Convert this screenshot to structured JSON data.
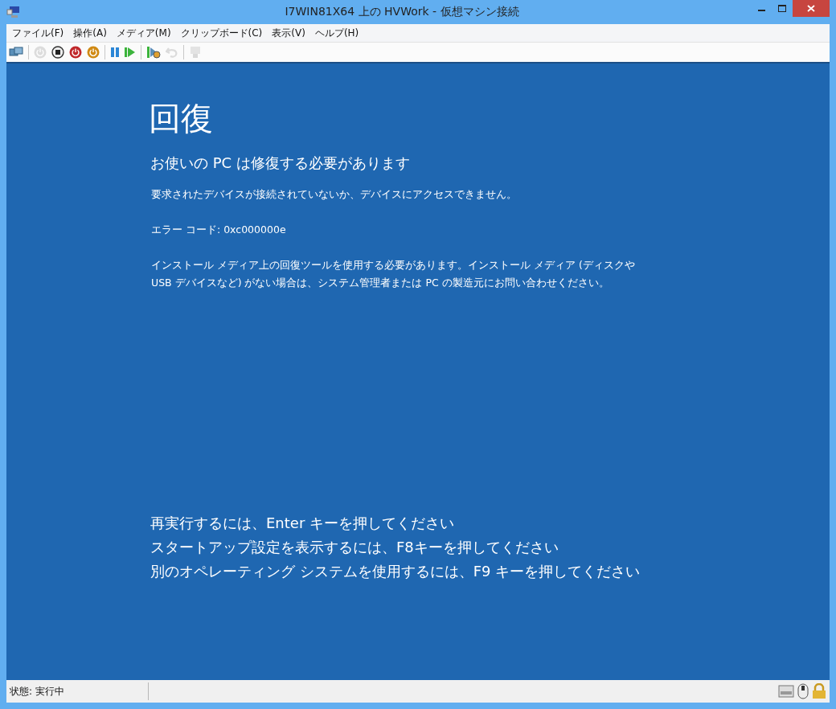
{
  "window": {
    "title": "I7WIN81X64 上の HVWork  - 仮想マシン接続"
  },
  "menu": [
    "ファイル(F)",
    "操作(A)",
    "メディア(M)",
    "クリップボード(C)",
    "表示(V)",
    "ヘルプ(H)"
  ],
  "toolbar": [
    {
      "kind": "ctrlaltdel",
      "disabled": false
    },
    {
      "kind": "sep"
    },
    {
      "kind": "start",
      "disabled": true
    },
    {
      "kind": "turnoff",
      "disabled": false
    },
    {
      "kind": "shutdown",
      "disabled": false
    },
    {
      "kind": "save",
      "disabled": false
    },
    {
      "kind": "sep"
    },
    {
      "kind": "pause",
      "disabled": false
    },
    {
      "kind": "reset",
      "disabled": false
    },
    {
      "kind": "sep"
    },
    {
      "kind": "checkpoint",
      "disabled": false
    },
    {
      "kind": "revert",
      "disabled": true
    },
    {
      "kind": "sep"
    },
    {
      "kind": "enhanced",
      "disabled": true
    }
  ],
  "screen": {
    "heading": "回復",
    "subheading": "お使いの PC は修復する必要があります",
    "paragraphs": [
      "要求されたデバイスが接続されていないか、デバイスにアクセスできません。",
      "エラー コード: 0xc000000e",
      "インストール メディア上の回復ツールを使用する必要があります。インストール メディア (ディスクや USB デバイスなど) がない場合は、システム管理者または PC の製造元にお問い合わせください。"
    ],
    "instructions": [
      "再実行するには、Enter キーを押してください",
      "スタートアップ設定を表示するには、F8キーを押してください",
      "別のオペレーティング システムを使用するには、F9 キーを押してください"
    ]
  },
  "status_bar": {
    "text": "状態: 実行中"
  }
}
